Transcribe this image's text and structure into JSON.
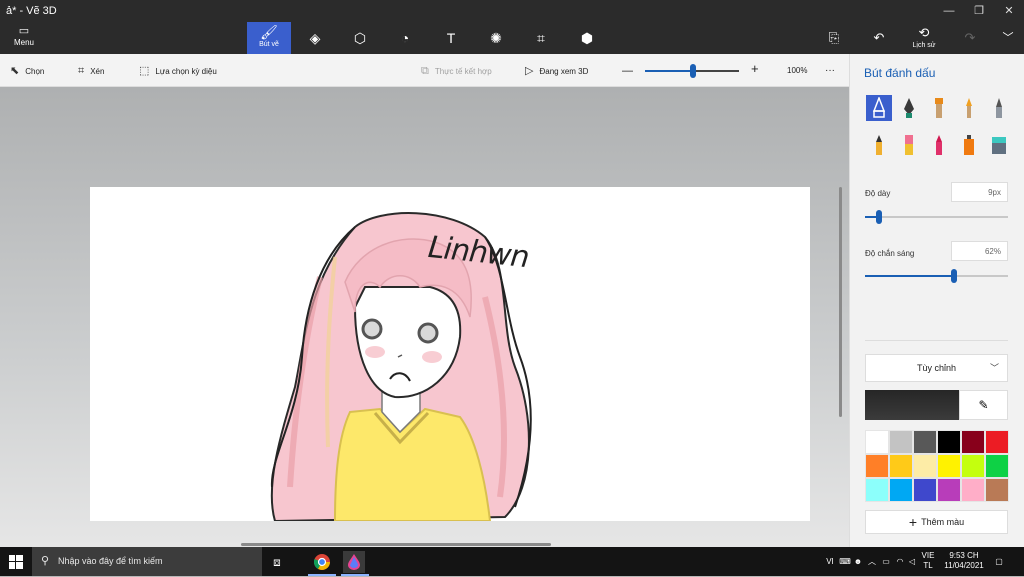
{
  "window": {
    "title": "ả* - Vẽ 3D",
    "controls": [
      "—",
      "❐",
      "✕"
    ]
  },
  "ribbon": {
    "menu_label": "Menu",
    "active_tool_label": "Bút vẽ",
    "history_label": "Lịch sử"
  },
  "commands": {
    "select": "Chọn",
    "crop": "Xén",
    "magic_select": "Lựa chọn kỳ diệu",
    "mixed_reality": "Thực tế kết hợp",
    "view_3d": "Đang xem 3D",
    "zoom_level": "100%",
    "more": "···"
  },
  "panel": {
    "title": "Bút đánh dấu",
    "thickness_label": "Độ dày",
    "thickness_value": "9px",
    "thickness_fraction": 0.1,
    "opacity_label": "Độ chắn sáng",
    "opacity_value": "62%",
    "opacity_fraction": 0.62,
    "dropdown_value": "Tùy chỉnh",
    "add_color_label": "Thêm màu",
    "current_color": "#262626",
    "swatches": [
      "#ffffff",
      "#c3c3c3",
      "#585858",
      "#000000",
      "#88001b",
      "#ec1c24",
      "#ff7f27",
      "#ffca18",
      "#fdeca6",
      "#fff200",
      "#c4ff0e",
      "#0ed145",
      "#8cfffb",
      "#00a8f3",
      "#3f48cc",
      "#b83dba",
      "#ffaec8",
      "#b97a56"
    ]
  },
  "drawing": {
    "signature_text": "Linhwn"
  },
  "taskbar": {
    "search_placeholder": "Nhập vào đây để tìm kiếm",
    "language_top": "VIE",
    "language_bottom": "TL",
    "time": "9:53 CH",
    "date": "11/04/2021",
    "tray_lang": "VI"
  },
  "zoom": {
    "fraction": 0.4
  }
}
